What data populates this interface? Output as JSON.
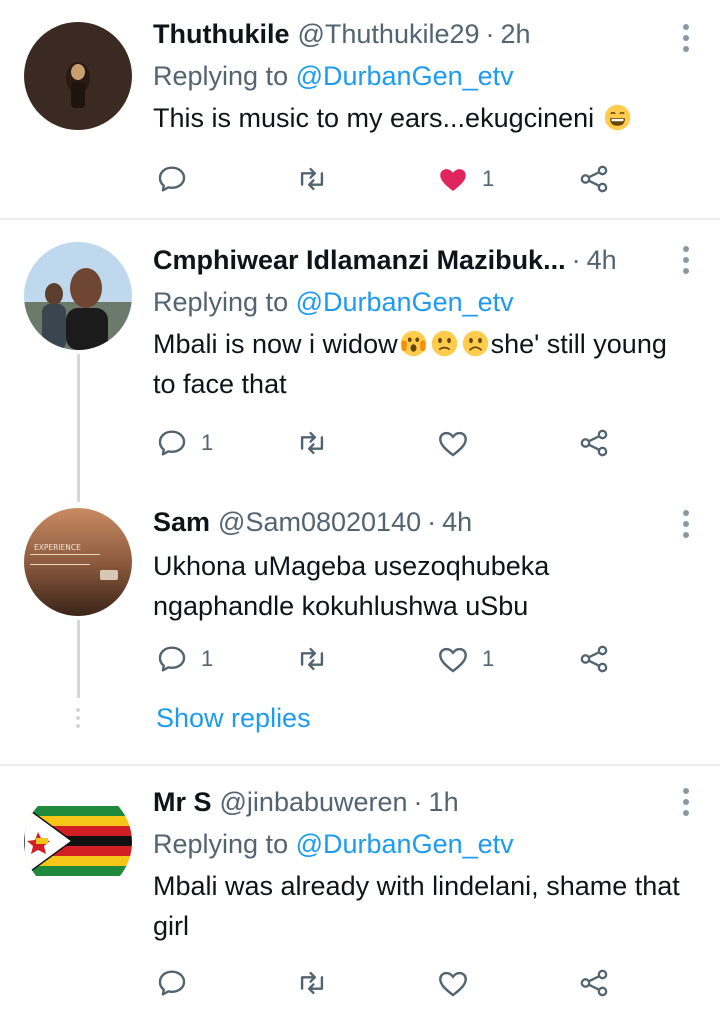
{
  "tweets": [
    {
      "name": "Thuthukile",
      "handle": "@Thuthukile29",
      "time": "2h",
      "replying_label": "Replying to",
      "replying_to": "@DurbanGen_etv",
      "text": "This is music to my ears...ekugcineni",
      "emoji_after": "grinning-face-emoji",
      "replies": "",
      "retweets": "",
      "likes": "1",
      "liked": true
    },
    {
      "name": "Cmphiwear Idlamanzi Mazibuk...",
      "handle": "",
      "time": "4h",
      "replying_label": "Replying to",
      "replying_to": "@DurbanGen_etv",
      "text_part1": "Mbali is now i widow",
      "text_part2": "she' still young to face that",
      "emojis": [
        "screaming-face-emoji",
        "confused-face-emoji",
        "frowning-face-emoji"
      ],
      "replies": "1",
      "retweets": "",
      "likes": "",
      "liked": false
    },
    {
      "name": "Sam",
      "handle": "@Sam08020140",
      "time": "4h",
      "text": "Ukhona uMageba usezoqhubeka ngaphandle kokuhlushwa uSbu",
      "avatar_text": "EXPERIENCE",
      "replies": "1",
      "retweets": "",
      "likes": "1",
      "liked": false
    },
    {
      "name": "Mr S",
      "handle": "@jinbabuweren",
      "time": "1h",
      "replying_label": "Replying to",
      "replying_to": "@DurbanGen_etv",
      "text": "Mbali was already with lindelani, shame that girl",
      "replies": "",
      "retweets": "",
      "likes": "",
      "liked": false
    }
  ],
  "show_replies": "Show replies",
  "colors": {
    "link": "#1d9bf0",
    "secondary": "#536471",
    "like_active": "#e0245e",
    "divider": "#e6ecf0"
  }
}
